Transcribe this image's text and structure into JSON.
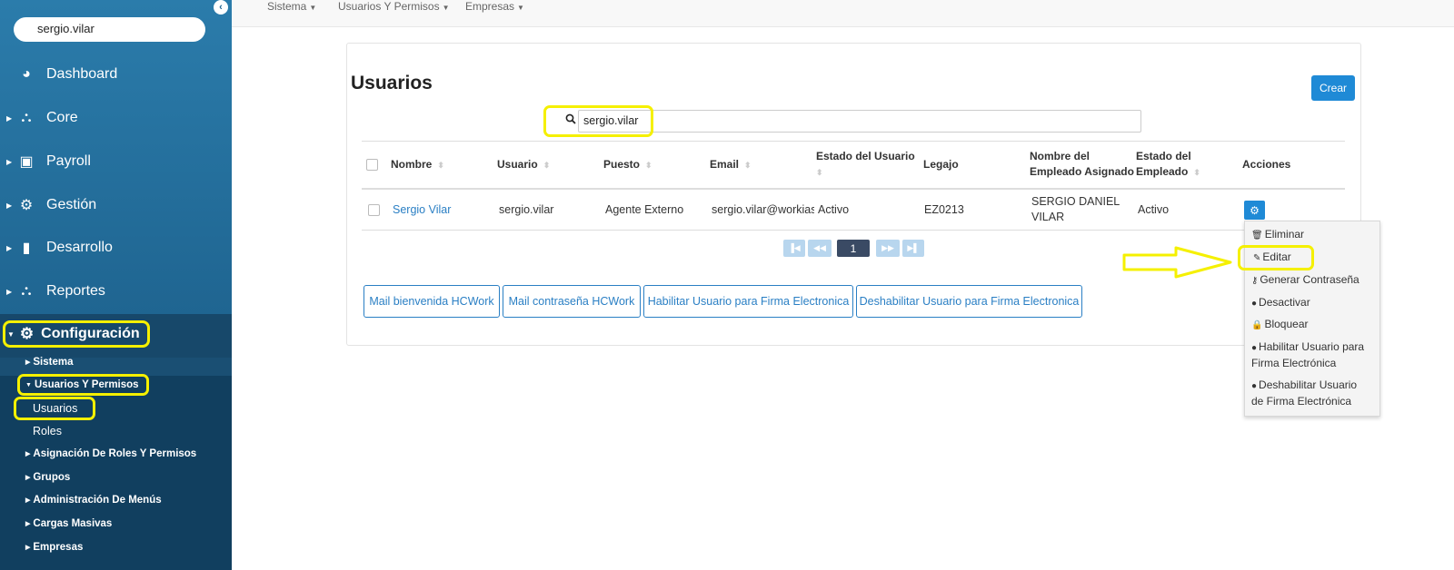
{
  "sidebar": {
    "collapse_icon": "chevron-left-icon",
    "user": "sergio.vilar",
    "items": [
      {
        "label": "Dashboard",
        "icon": "dashboard-icon"
      },
      {
        "label": "Core",
        "icon": "sitemap-icon"
      },
      {
        "label": "Payroll",
        "icon": "money-icon"
      },
      {
        "label": "Gestión",
        "icon": "user-cog-icon"
      },
      {
        "label": "Desarrollo",
        "icon": "book-icon"
      },
      {
        "label": "Reportes",
        "icon": "sitemap-icon"
      }
    ],
    "config": {
      "label": "Configuración",
      "icon": "gear-icon",
      "sub": [
        {
          "label": "Sistema"
        },
        {
          "label": "Usuarios Y Permisos"
        },
        {
          "label": "Asignación De Roles Y Permisos"
        },
        {
          "label": "Grupos"
        },
        {
          "label": "Administración De Menús"
        },
        {
          "label": "Cargas Masivas"
        },
        {
          "label": "Empresas"
        }
      ],
      "leaves": [
        {
          "label": "Usuarios"
        },
        {
          "label": "Roles"
        }
      ]
    }
  },
  "topmenu": [
    "Sistema",
    "Usuarios Y Permisos",
    "Empresas"
  ],
  "page": {
    "title": "Usuarios",
    "create_label": "Crear",
    "search_value": "sergio.vilar"
  },
  "table": {
    "headers": {
      "nombre": "Nombre",
      "usuario": "Usuario",
      "puesto": "Puesto",
      "email": "Email",
      "estado_usuario": "Estado del Usuario",
      "legajo": "Legajo",
      "empleado_l1": "Nombre del",
      "empleado_l2": "Empleado Asignado",
      "estado_emp_l1": "Estado del",
      "estado_emp_l2": "Empleado",
      "acciones": "Acciones"
    },
    "row": {
      "nombre": "Sergio Vilar",
      "usuario": "sergio.vilar",
      "puesto": "Agente Externo",
      "email": "sergio.vilar@workias",
      "estado_usuario": "Activo",
      "legajo": "EZ0213",
      "empleado_l1": "SERGIO DANIEL",
      "empleado_l2": "VILAR",
      "estado_empleado": "Activo"
    }
  },
  "pagination": {
    "current": "1"
  },
  "buttons": [
    "Mail bienvenida HCWork",
    "Mail contraseña HCWork",
    "Habilitar Usuario para Firma Electronica",
    "Deshabilitar Usuario para Firma Electronica"
  ],
  "dropdown": {
    "eliminar": "Eliminar",
    "editar": "Editar",
    "generar": "Generar Contraseña",
    "desactivar": "Desactivar",
    "bloquear": "Bloquear",
    "habilitar_l1": "Habilitar Usuario para",
    "habilitar_l2": "Firma Electrónica",
    "deshabilitar_l1": "Deshabilitar Usuario",
    "deshabilitar_l2": "de Firma Electrónica"
  },
  "colors": {
    "sidebar": "#1f6591",
    "accent": "#1f8ad6",
    "highlight": "#f5f000"
  }
}
